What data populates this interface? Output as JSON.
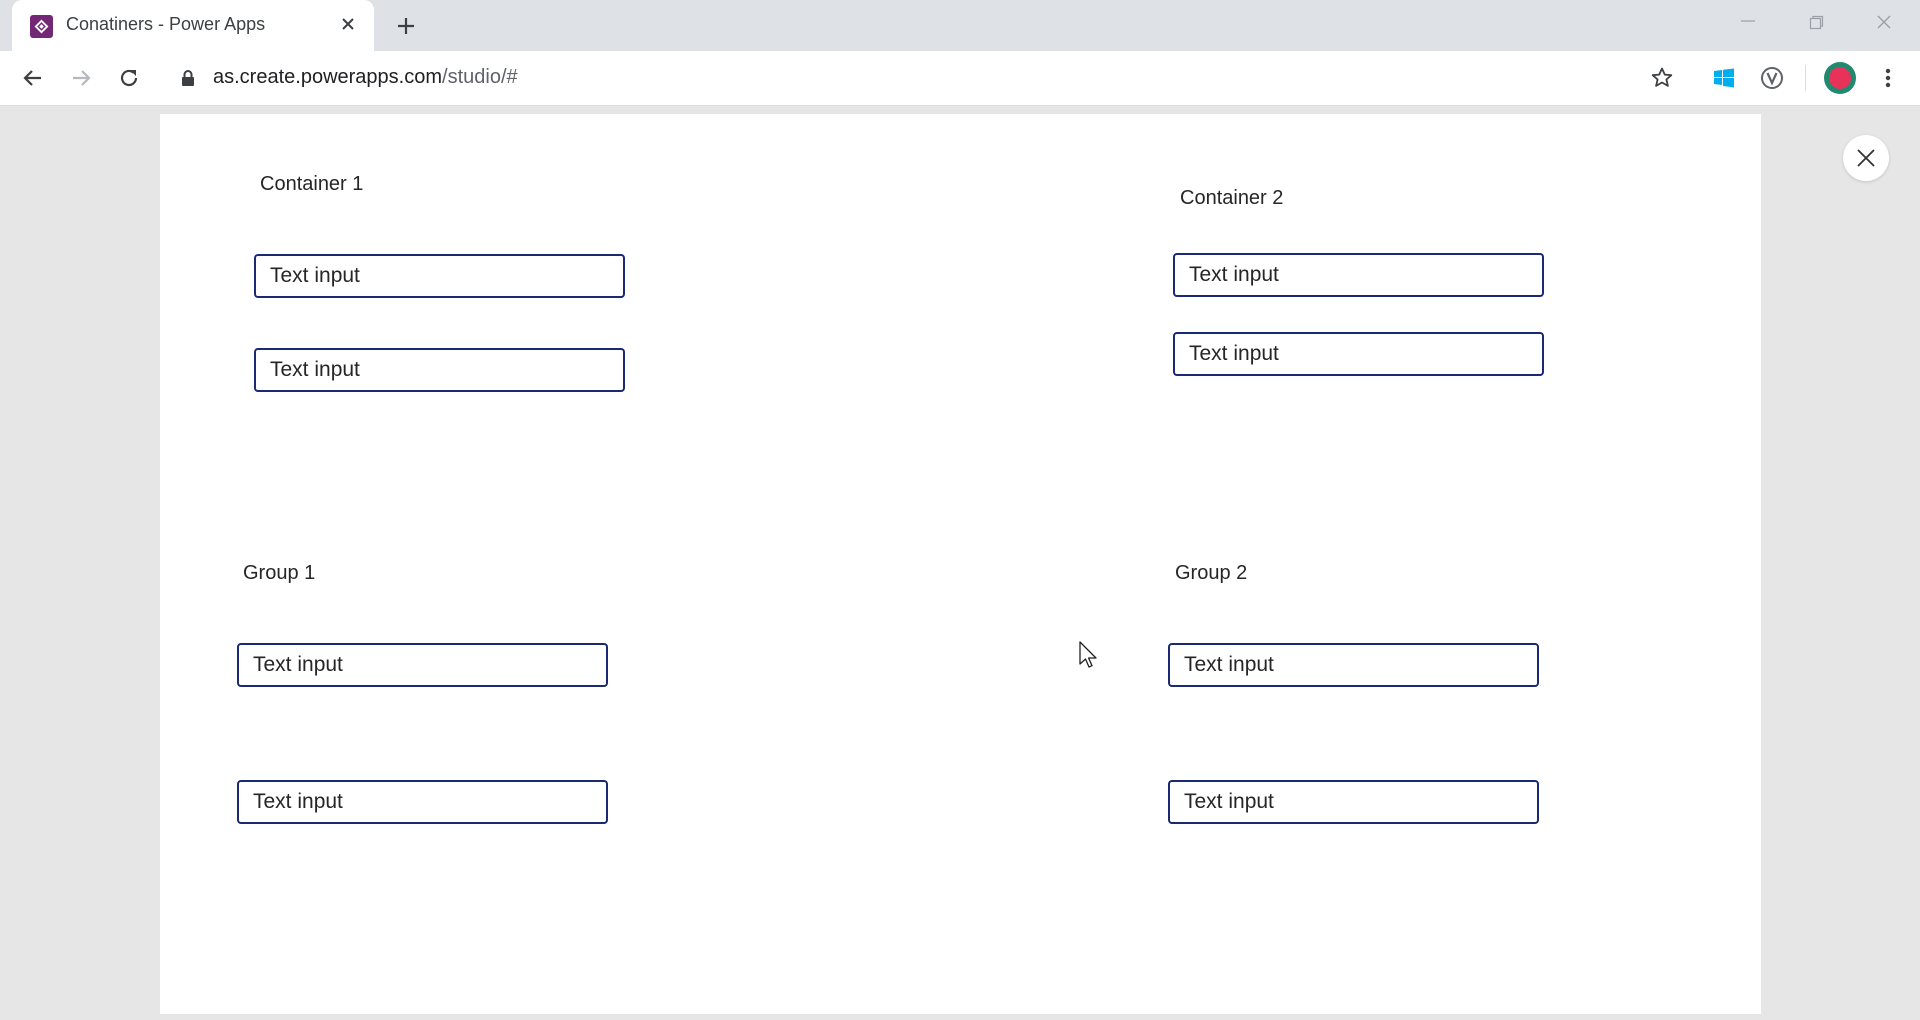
{
  "browser": {
    "tab_title": "Conatiners - Power Apps",
    "url_host": "as.create.powerapps.com",
    "url_path": "/studio/#",
    "icons": [
      "power-apps-icon",
      "close-icon",
      "plus-icon",
      "minimize-icon",
      "restore-icon",
      "close-icon",
      "back-icon",
      "forward-icon",
      "reload-icon",
      "lock-icon",
      "star-icon",
      "windows-icon",
      "extension-icon",
      "avatar",
      "menu-icon"
    ]
  },
  "screen": {
    "container1": {
      "label": "Container 1",
      "inputs": [
        {
          "value": "Text input"
        },
        {
          "value": "Text input"
        }
      ]
    },
    "container2": {
      "label": "Container 2",
      "inputs": [
        {
          "value": "Text input"
        },
        {
          "value": "Text input"
        }
      ]
    },
    "group1": {
      "label": "Group 1",
      "inputs": [
        {
          "value": "Text input"
        },
        {
          "value": "Text input"
        }
      ]
    },
    "group2": {
      "label": "Group 2",
      "inputs": [
        {
          "value": "Text input"
        },
        {
          "value": "Text input"
        }
      ]
    }
  },
  "colors": {
    "input_border": "#1b2872",
    "brand": "#742774",
    "canvas_background": "#ffffff",
    "page_background": "#e6e6e6"
  }
}
